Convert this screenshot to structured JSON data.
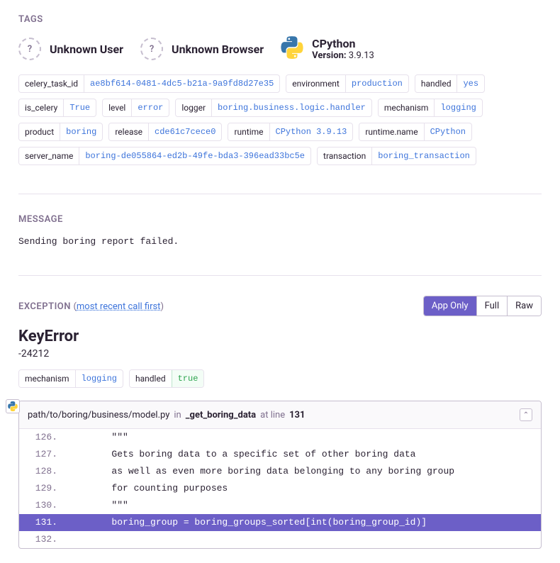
{
  "tags_title": "TAGS",
  "cards": {
    "user": {
      "glyph": "?",
      "title": "Unknown User"
    },
    "browser": {
      "glyph": "?",
      "title": "Unknown Browser"
    },
    "runtime": {
      "title": "CPython",
      "version_label": "Version:",
      "version_value": "3.9.13"
    }
  },
  "tags": [
    {
      "k": "celery_task_id",
      "v": "ae8bf614-0481-4dc5-b21a-9a9fd8d27e35"
    },
    {
      "k": "environment",
      "v": "production"
    },
    {
      "k": "handled",
      "v": "yes"
    },
    {
      "k": "is_celery",
      "v": "True"
    },
    {
      "k": "level",
      "v": "error"
    },
    {
      "k": "logger",
      "v": "boring.business.logic.handler"
    },
    {
      "k": "mechanism",
      "v": "logging"
    },
    {
      "k": "product",
      "v": "boring"
    },
    {
      "k": "release",
      "v": "cde61c7cece0"
    },
    {
      "k": "runtime",
      "v": "CPython 3.9.13"
    },
    {
      "k": "runtime.name",
      "v": "CPython"
    },
    {
      "k": "server_name",
      "v": "boring-de055864-ed2b-49fe-bda3-396ead33bc5e"
    },
    {
      "k": "transaction",
      "v": "boring_transaction"
    }
  ],
  "message": {
    "title": "MESSAGE",
    "text": "Sending boring report failed."
  },
  "exception": {
    "title": "EXCEPTION",
    "paren_open": "(",
    "paren_close": ")",
    "order_link": "most recent call first",
    "btns": {
      "app_only": "App Only",
      "full": "Full",
      "raw": "Raw"
    },
    "name": "KeyError",
    "value": "-24212",
    "ex_tags": [
      {
        "k": "mechanism",
        "v": "logging",
        "cls": ""
      },
      {
        "k": "handled",
        "v": "true",
        "cls": "green"
      }
    ],
    "frame": {
      "path": "path/to/boring/business/model.py",
      "in": "in",
      "fn": "_get_boring_data",
      "atline": "at line",
      "line": "131",
      "code": [
        {
          "n": "126",
          "src": "        \"\"\"",
          "hl": false
        },
        {
          "n": "127",
          "src": "        Gets boring data to a specific set of other boring data",
          "hl": false
        },
        {
          "n": "128",
          "src": "        as well as even more boring data belonging to any boring group",
          "hl": false
        },
        {
          "n": "129",
          "src": "        for counting purposes",
          "hl": false
        },
        {
          "n": "130",
          "src": "        \"\"\"",
          "hl": false
        },
        {
          "n": "131",
          "src": "        boring_group = boring_groups_sorted[int(boring_group_id)]",
          "hl": true
        },
        {
          "n": "132",
          "src": "",
          "hl": false
        }
      ]
    }
  }
}
